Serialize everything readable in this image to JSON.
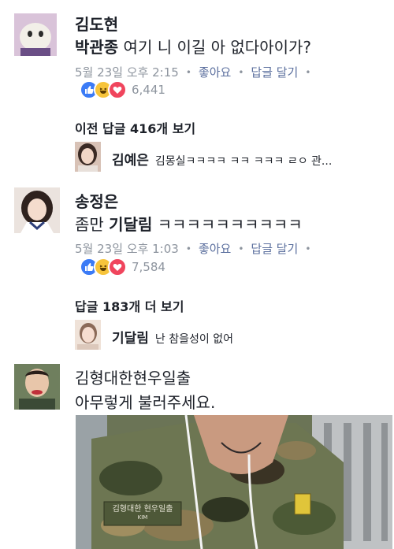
{
  "comments": [
    {
      "author": "김도현",
      "mention": "박관종",
      "text": " 여기 니 이길 아 없다아이가?",
      "time": "5월 23일 오후 2:15",
      "like": "좋아요",
      "reply": "답글 달기",
      "reaction_count": "6,441"
    },
    {
      "author": "송정은",
      "text_plain": "좀만 ",
      "mention": "기달림",
      "text": " ㅋㅋㅋㅋㅋㅋㅋㅋㅋㅋ",
      "time": "5월 23일 오후 1:03",
      "like": "좋아요",
      "reply": "답글 달기",
      "reaction_count": "7,584"
    },
    {
      "author": "김형대한현우일출",
      "text": "아무렇게 불러주세요."
    }
  ],
  "more_replies_1": "이전 답글 416개 보기",
  "reply_1": {
    "author": "김예은",
    "text": "김몽실ㅋㅋㅋㅋ ㅋㅋ ㅋㅋㅋ ㄹㅇ 관..."
  },
  "more_replies_2": "답글 183개 더 보기",
  "reply_2": {
    "author": "기달림",
    "text": "난 참을성이 없어"
  },
  "photo": {
    "name_tag": "김형대한 현우일출",
    "tag_small": "KIM"
  },
  "colors": {
    "like": "#3b7bf6",
    "haha": "#f7c43b",
    "love": "#f0455d"
  }
}
